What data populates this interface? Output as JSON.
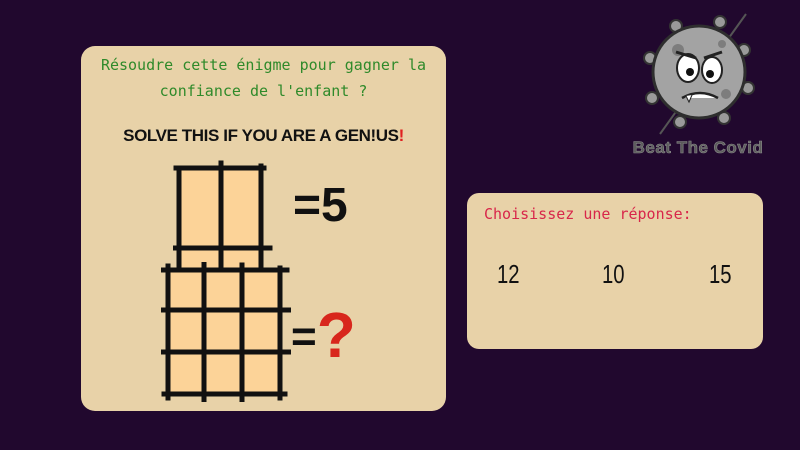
{
  "puzzle": {
    "prompt_lines": [
      "Résoudre cette énigme pour gagner la",
      "confiance de l'enfant ?"
    ],
    "headline": "SOLVE THIS IF YOU ARE A GEN!US",
    "headline_exclaim": "!",
    "equation_1": "=5",
    "equation_2_prefix": "=",
    "equation_2_mark": "?",
    "grid_small_size": "2x2",
    "grid_large_size": "3x3"
  },
  "logo": {
    "text": "Beat The Covid",
    "icon": "virus-mascot-icon"
  },
  "answer": {
    "title": "Choisissez une réponse:",
    "options": [
      "12",
      "10",
      "15"
    ]
  },
  "colors": {
    "background": "#21082e",
    "card": "#e8d2a8",
    "prompt_green": "#2f8a2a",
    "answer_title_red": "#d8264a",
    "cell_fill": "#fcd398",
    "question_red": "#d8261c"
  }
}
